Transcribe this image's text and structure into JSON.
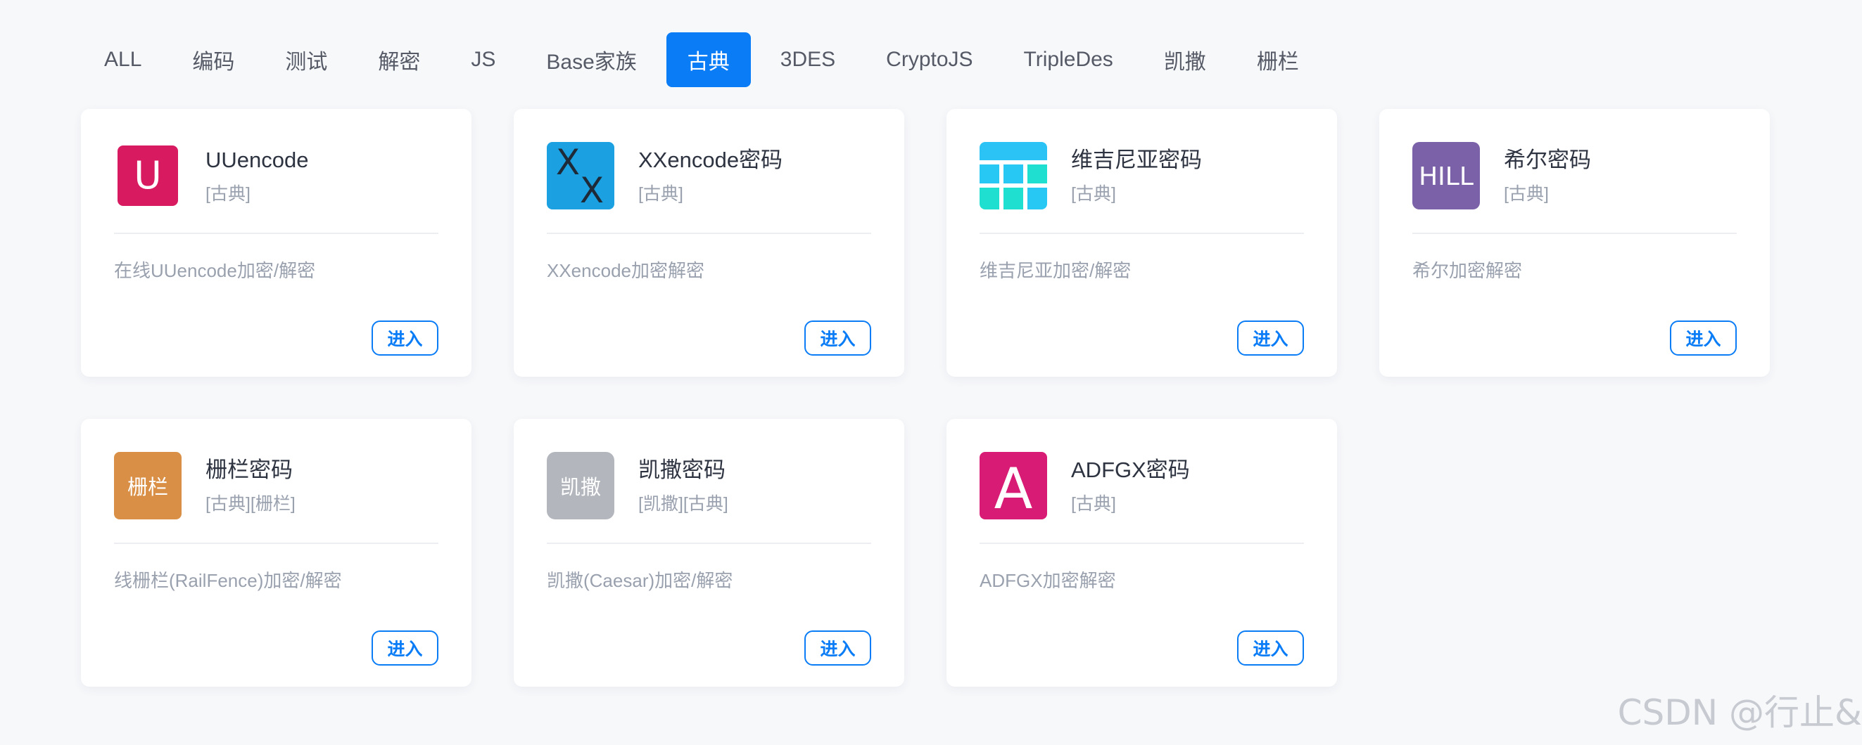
{
  "tabs": [
    {
      "label": "ALL",
      "active": false
    },
    {
      "label": "编码",
      "active": false
    },
    {
      "label": "测试",
      "active": false
    },
    {
      "label": "解密",
      "active": false
    },
    {
      "label": "JS",
      "active": false
    },
    {
      "label": "Base家族",
      "active": false
    },
    {
      "label": "古典",
      "active": true
    },
    {
      "label": "3DES",
      "active": false
    },
    {
      "label": "CryptoJS",
      "active": false
    },
    {
      "label": "TripleDes",
      "active": false
    },
    {
      "label": "凯撒",
      "active": false
    },
    {
      "label": "栅栏",
      "active": false
    }
  ],
  "cards": [
    {
      "title": "UUencode",
      "tags": "[古典]",
      "description": "在线UUencode加密/解密",
      "icon": {
        "name": "uuencode-icon",
        "text": "U",
        "color": "#d81b60"
      }
    },
    {
      "title": "XXencode密码",
      "tags": "[古典]",
      "description": "XXencode加密解密",
      "icon": {
        "name": "xxencode-icon",
        "text": "XX",
        "color": "#1ba1e2"
      }
    },
    {
      "title": "维吉尼亚密码",
      "tags": "[古典]",
      "description": "维吉尼亚加密/解密",
      "icon": {
        "name": "vigenere-table-icon",
        "text": "",
        "color": "#29c7f5"
      }
    },
    {
      "title": "希尔密码",
      "tags": "[古典]",
      "description": "希尔加密解密",
      "icon": {
        "name": "hill-icon",
        "text": "HILL",
        "color": "#7b61a8"
      }
    },
    {
      "title": "栅栏密码",
      "tags": "[古典][栅栏]",
      "description": "线栅栏(RailFence)加密/解密",
      "icon": {
        "name": "rail-fence-icon",
        "text": "栅栏",
        "color": "#d98f45"
      }
    },
    {
      "title": "凯撒密码",
      "tags": "[凯撒][古典]",
      "description": "凯撒(Caesar)加密/解密",
      "icon": {
        "name": "caesar-icon",
        "text": "凯撒",
        "color": "#b3b7bd"
      }
    },
    {
      "title": "ADFGX密码",
      "tags": "[古典]",
      "description": "ADFGX加密解密",
      "icon": {
        "name": "adfgx-icon",
        "text": "A",
        "color": "#d81b75"
      }
    }
  ],
  "enter_label": "进入",
  "watermark": "CSDN @行止&",
  "colors": {
    "accent": "#0a7cf6",
    "background": "#f7f8fa",
    "card": "#ffffff"
  }
}
